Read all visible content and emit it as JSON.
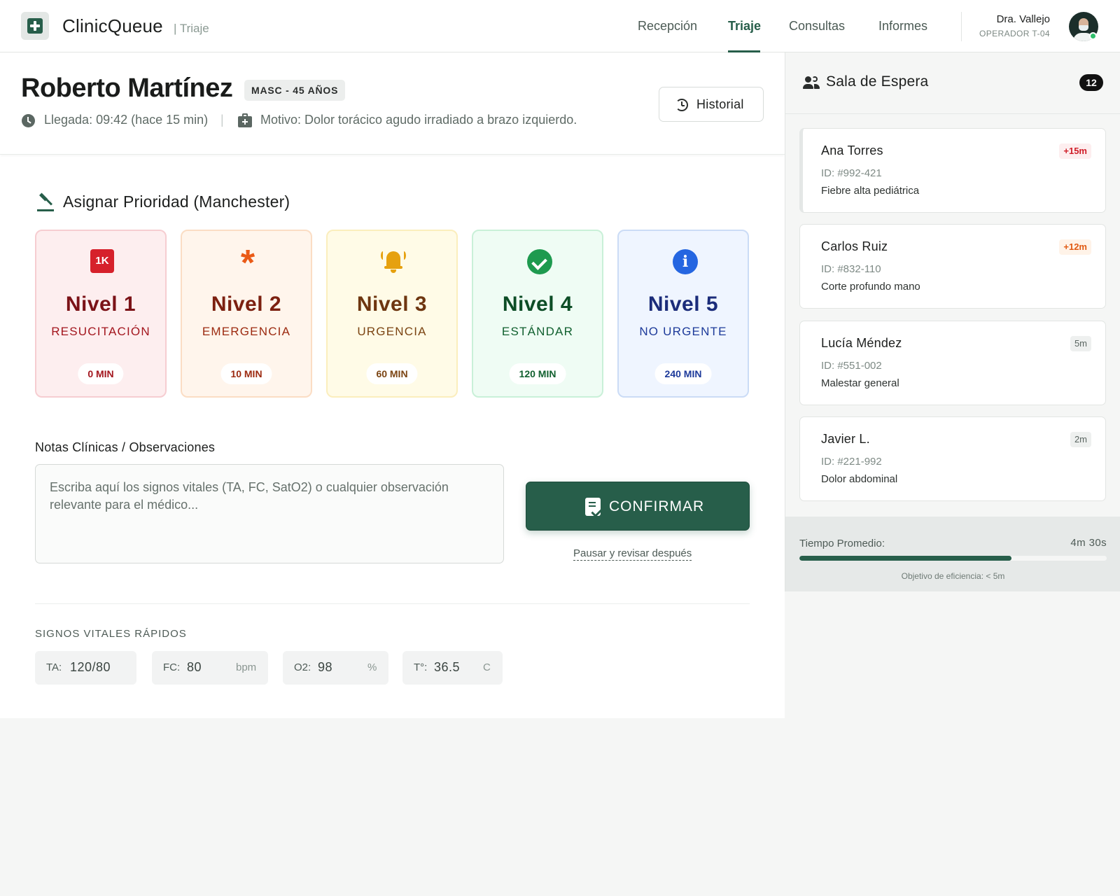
{
  "header": {
    "app_name": "ClinicQueue",
    "app_section": "| Triaje",
    "nav": [
      {
        "label": "Recepción",
        "active": false
      },
      {
        "label": "Triaje",
        "active": true
      },
      {
        "label": "Consultas",
        "active": false
      },
      {
        "label": "Informes",
        "active": false
      }
    ],
    "user": {
      "name": "Dra. Vallejo",
      "role": "OPERADOR T-04",
      "status_color": "#2fbf6b"
    }
  },
  "patient": {
    "name": "Roberto Martínez",
    "badge": "MASC - 45 AÑOS",
    "arrival": "Llegada: 09:42 (hace 15 min)",
    "separator": "|",
    "reason": "Motivo: Dolor torácico agudo irradiado a brazo izquierdo.",
    "history_button": "Historial",
    "icons": {
      "arrival": "clock-icon",
      "reason": "medical-kit-icon",
      "history": "history-icon"
    }
  },
  "priority": {
    "title": "Asignar Prioridad (Manchester)",
    "title_icon": "gavel-icon",
    "levels": [
      {
        "name": "Nivel 1",
        "label": "RESUCITACIÓN",
        "time": "0 MIN",
        "icon": "1k-icon",
        "icon_text": "1K",
        "accent": "#d6212b"
      },
      {
        "name": "Nivel 2",
        "label": "EMERGENCIA",
        "time": "10 MIN",
        "icon": "asterisk-icon",
        "icon_text": "*",
        "accent": "#ea5a16"
      },
      {
        "name": "Nivel 3",
        "label": "URGENCIA",
        "time": "60 MIN",
        "icon": "bell-icon",
        "accent": "#e6a10f"
      },
      {
        "name": "Nivel 4",
        "label": "ESTÁNDAR",
        "time": "120 MIN",
        "icon": "check-circle-icon",
        "accent": "#1e9a4f"
      },
      {
        "name": "Nivel 5",
        "label": "NO URGENTE",
        "time": "240 MIN",
        "icon": "info-icon",
        "icon_text": "i",
        "accent": "#2566e1"
      }
    ]
  },
  "notes": {
    "label": "Notas Clínicas / Observaciones",
    "placeholder": "Escriba aquí los signos vitales (TA, FC, SatO2) o cualquier observación relevante para el médico...",
    "value": ""
  },
  "actions": {
    "confirm_label": "CONFIRMAR",
    "pause_label": "Pausar y revisar después",
    "primary_color": "#275e4a"
  },
  "vitals": {
    "title": "SIGNOS VITALES RÁPIDOS",
    "fields": [
      {
        "key": "TA:",
        "value": "120/80",
        "unit": ""
      },
      {
        "key": "FC:",
        "value": "80",
        "unit": "bpm"
      },
      {
        "key": "O2:",
        "value": "98",
        "unit": "%"
      },
      {
        "key": "T°:",
        "value": "36.5",
        "unit": "C"
      }
    ]
  },
  "waiting_room": {
    "title": "Sala de Espera",
    "count": "12",
    "patients": [
      {
        "name": "Ana Torres",
        "id": "ID: #992-421",
        "reason": "Fiebre alta pediátrica",
        "wait": "+15m",
        "wait_color": "#d01e29"
      },
      {
        "name": "Carlos Ruiz",
        "id": "ID: #832-110",
        "reason": "Corte profundo mano",
        "wait": "+12m",
        "wait_color": "#e15a12"
      },
      {
        "name": "Lucía Méndez",
        "id": "ID: #551-002",
        "reason": "Malestar general",
        "wait": "5m",
        "wait_color": "#5b6662"
      },
      {
        "name": "Javier L.",
        "id": "ID: #221-992",
        "reason": "Dolor abdominal",
        "wait": "2m",
        "wait_color": "#5b6662"
      }
    ],
    "avg_label": "Tiempo Promedio:",
    "avg_value": "4m 30s",
    "avg_progress": 0.69,
    "goal": "Objetivo de eficiencia: < 5m"
  }
}
